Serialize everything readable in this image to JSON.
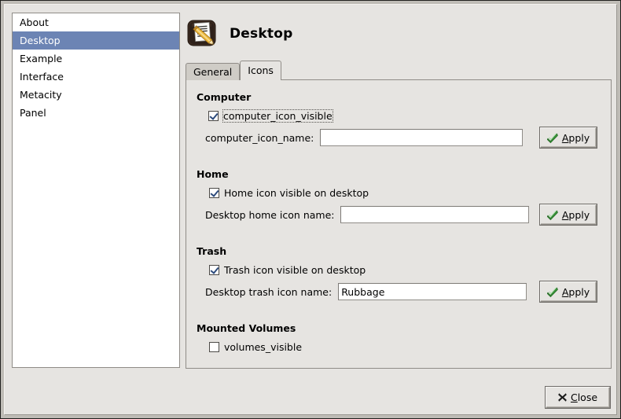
{
  "window": {
    "title": "Desktop"
  },
  "sidebar": {
    "items": [
      {
        "label": "About",
        "selected": false
      },
      {
        "label": "Desktop",
        "selected": true
      },
      {
        "label": "Example",
        "selected": false
      },
      {
        "label": "Interface",
        "selected": false
      },
      {
        "label": "Metacity",
        "selected": false
      },
      {
        "label": "Panel",
        "selected": false
      }
    ]
  },
  "header": {
    "icon": "document-pencil-icon",
    "title": "Desktop"
  },
  "tabs": [
    {
      "label": "General",
      "active": false
    },
    {
      "label": "Icons",
      "active": true
    }
  ],
  "groups": [
    {
      "title": "Computer",
      "checkbox": {
        "label": "computer_icon_visible",
        "checked": true,
        "focused": true
      },
      "entry": {
        "label": "computer_icon_name:",
        "value": "",
        "placeholder": ""
      },
      "apply": {
        "label": "Apply",
        "mnemonic": "A",
        "icon": "green-check-icon"
      }
    },
    {
      "title": "Home",
      "checkbox": {
        "label": "Home icon visible on desktop",
        "checked": true,
        "focused": false
      },
      "entry": {
        "label": "Desktop home icon name:",
        "value": "",
        "placeholder": ""
      },
      "apply": {
        "label": "Apply",
        "mnemonic": "A",
        "icon": "green-check-icon"
      }
    },
    {
      "title": "Trash",
      "checkbox": {
        "label": "Trash icon visible on desktop",
        "checked": true,
        "focused": false
      },
      "entry": {
        "label": "Desktop trash icon name:",
        "value": "Rubbage",
        "placeholder": ""
      },
      "apply": {
        "label": "Apply",
        "mnemonic": "A",
        "icon": "green-check-icon"
      }
    },
    {
      "title": "Mounted Volumes",
      "checkbox": {
        "label": "volumes_visible",
        "checked": false,
        "focused": false
      },
      "entry": null,
      "apply": null
    }
  ],
  "close_button": {
    "label": "Close",
    "mnemonic": "C",
    "icon": "x-close-icon"
  },
  "colors": {
    "window_bg": "#e6e4e1",
    "selection_blue": "#6c84b4",
    "list_bg": "#ffffff",
    "border_gray": "#8f8c87",
    "check_blue": "#2c4a7c",
    "apply_check_green": "#3a9e3a"
  }
}
